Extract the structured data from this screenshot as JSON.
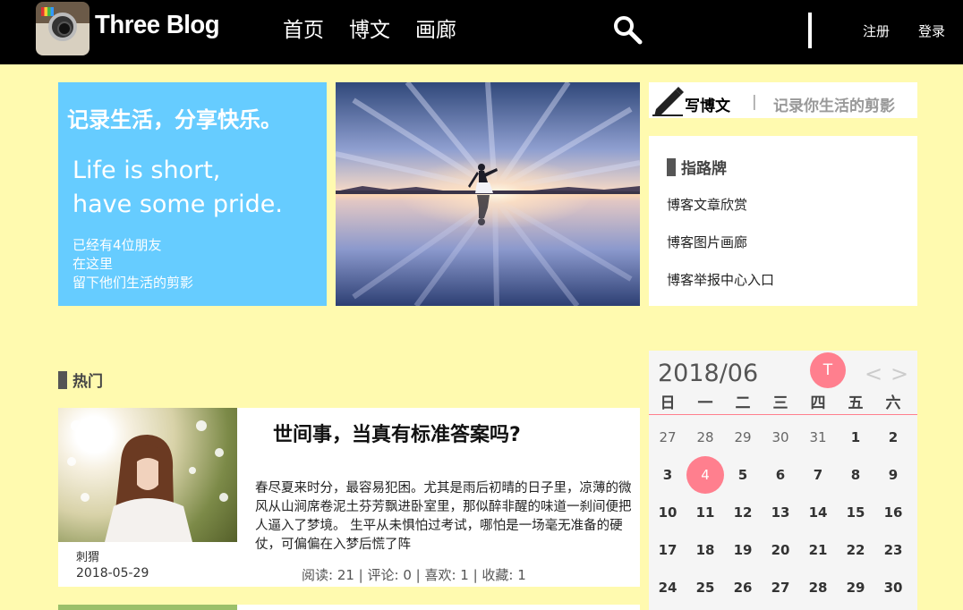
{
  "header": {
    "brand": "Three Blog",
    "nav": [
      "首页",
      "博文",
      "画廊"
    ],
    "register": "注册",
    "login": "登录"
  },
  "intro": {
    "motto": "记录生活，分享快乐。",
    "english_line1": "Life is short,",
    "english_line2": "have some pride.",
    "line1": "已经有4位朋友",
    "line2": "在这里",
    "line3": "留下他们生活的剪影"
  },
  "write": {
    "label": "写博文",
    "separator": "|",
    "slogan": "记录你生活的剪影"
  },
  "guide": {
    "title": "指路牌",
    "links": [
      "博客文章欣赏",
      "博客图片画廊",
      "博客举报中心入口"
    ]
  },
  "hot": {
    "title": "热门"
  },
  "article": {
    "title": "世间事，当真有标准答案吗?",
    "excerpt": "春尽夏来时分，最容易犯困。尤其是雨后初晴的日子里，凉薄的微风从山涧席卷泥土芬芳飘进卧室里，那似醉非醒的味道一刹间便把人逼入了梦境。 生平从未惧怕过考试，哪怕是一场毫无准备的硬仗，可偏偏在入梦后慌了阵",
    "author": "刺猬",
    "date": "2018-05-29",
    "stats": "阅读: 21   | 评论: 0   | 喜欢: 1   | 收藏: 1"
  },
  "calendar": {
    "month": "2018/06",
    "today": "T",
    "prev": "<",
    "next": ">",
    "weekdays": [
      "日",
      "一",
      "二",
      "三",
      "四",
      "五",
      "六"
    ],
    "days": [
      "27",
      "28",
      "29",
      "30",
      "31",
      "1",
      "2",
      "3",
      "4",
      "5",
      "6",
      "7",
      "8",
      "9",
      "10",
      "11",
      "12",
      "13",
      "14",
      "15",
      "16",
      "17",
      "18",
      "19",
      "20",
      "21",
      "22",
      "23",
      "24",
      "25",
      "26",
      "27",
      "28",
      "29",
      "30"
    ],
    "selected_day": "4",
    "accent_color": "#ff7f8e"
  },
  "colors": {
    "page_bg": "#fffaaf",
    "header_bg": "#000000",
    "intro_bg": "#66ccff"
  },
  "icons": [
    "camera-logo-icon",
    "search-icon",
    "pen-icon"
  ]
}
